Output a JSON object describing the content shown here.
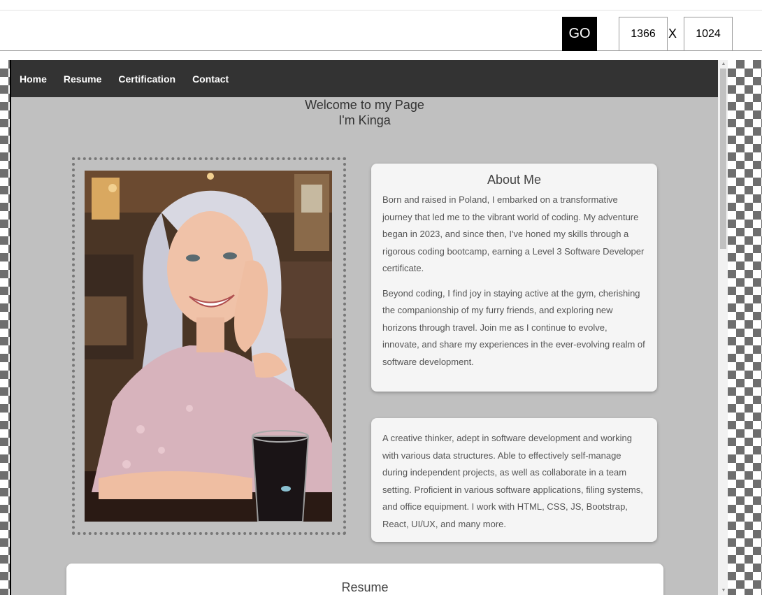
{
  "toolbar": {
    "go_label": "GO",
    "width_value": "1366",
    "height_value": "1024",
    "x_label": "X"
  },
  "nav": {
    "items": [
      {
        "label": "Home"
      },
      {
        "label": "Resume"
      },
      {
        "label": "Certification"
      },
      {
        "label": "Contact"
      }
    ]
  },
  "hero": {
    "welcome": "Welcome to my Page",
    "name": "I'm Kinga"
  },
  "about": {
    "title": "About Me",
    "paragraphs": [
      "Born and raised in Poland, I embarked on a transformative journey that led me to the vibrant world of coding. My adventure began in 2023, and since then, I've honed my skills through a rigorous coding bootcamp, earning a Level 3 Software Developer certificate.",
      "Beyond coding, I find joy in staying active at the gym, cherishing the companionship of my furry friends, and exploring new horizons through travel. Join me as I continue to evolve, innovate, and share my experiences in the ever-evolving realm of software development."
    ]
  },
  "skills": {
    "text": "A creative thinker, adept in software development and working with various data structures. Able to effectively self-manage during independent projects, as well as collaborate in a team setting. Proficient in various software applications, filing systems, and office equipment. I work with HTML, CSS, JS, Bootstrap, React, UI/UX, and many more."
  },
  "resume": {
    "title": "Resume"
  },
  "colors": {
    "navbar": "#333333",
    "page_bg": "#c0c0c0",
    "card_bg": "#f5f5f5",
    "go_button": "#000000"
  }
}
